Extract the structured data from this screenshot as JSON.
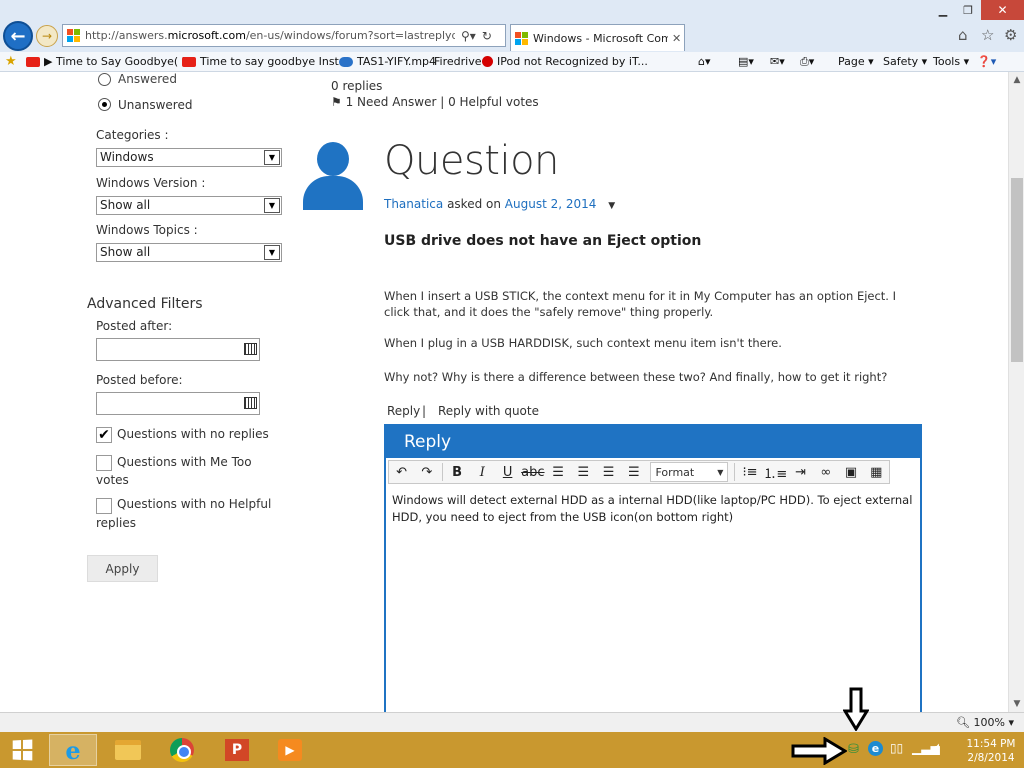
{
  "browser": {
    "url_prefix": "http://answers.",
    "url_domain": "microsoft.com",
    "url_rest": "/en-us/windows/forum?sort=lastreplydate&dir=c",
    "tab_title": "Windows - Microsoft Com...",
    "favorites": [
      "▶ Time to Say Goodbye( I...",
      "Time to say goodbye Instr...",
      "TAS1-YIFY.mp4",
      "Firedrive",
      "IPod not Recognized by iT..."
    ],
    "commands": {
      "page": "Page ▾",
      "safety": "Safety ▾",
      "tools": "Tools ▾"
    }
  },
  "sidebar": {
    "radio_answered": "Answered",
    "radio_unanswered": "Unanswered",
    "categories_label": "Categories :",
    "categories_value": "Windows",
    "version_label": "Windows Version :",
    "version_value": "Show all",
    "topics_label": "Windows Topics :",
    "topics_value": "Show all",
    "advanced_title": "Advanced Filters",
    "posted_after": "Posted after:",
    "posted_before": "Posted before:",
    "chk_no_replies": "Questions with no replies",
    "chk_me_too_1": "Questions with Me Too",
    "chk_me_too_2": "votes",
    "chk_no_helpful_1": "Questions with no Helpful",
    "chk_no_helpful_2": "replies",
    "apply": "Apply"
  },
  "thread": {
    "replies": "0 replies",
    "meta": "1 Need Answer | 0 Helpful votes",
    "heading": "Question",
    "author": "Thanatica",
    "asked_on": "asked on",
    "date": "August 2, 2014",
    "subject": "USB drive does not have an Eject option",
    "para1": "When I insert a USB STICK, the context menu for it in My Computer has an option Eject. I click that, and it does the \"safely remove\" thing properly.",
    "para2": "When I plug in a USB HARDDISK, such context menu item isn't there.",
    "para3": "Why not? Why is there a difference between these two? And finally, how to get it right?",
    "reply_link": "Reply",
    "reply_sep": "|",
    "reply_quote": "Reply with quote"
  },
  "editor": {
    "header": "Reply",
    "format": "Format",
    "text": "Windows will detect external HDD as a internal HDD(like laptop/PC HDD). To eject external HDD, you need to eject from the USB icon(on bottom right)"
  },
  "status": {
    "zoom": "100%"
  },
  "taskbar": {
    "time": "11:54 PM",
    "date": "2/8/2014"
  },
  "colors": {
    "accent": "#1f73c3",
    "taskbar": "#c9982f",
    "link": "#1e6fbf"
  }
}
